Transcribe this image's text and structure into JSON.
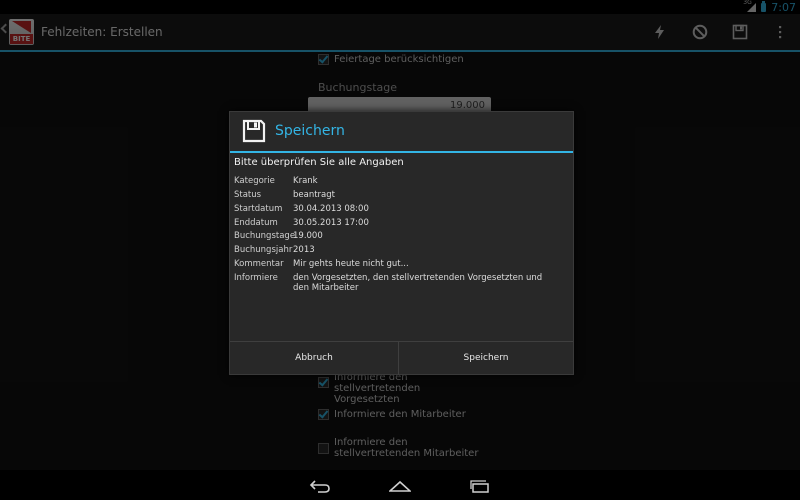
{
  "status_bar": {
    "network": "3G",
    "time": "7:07",
    "accent": "#33b5e5"
  },
  "action_bar": {
    "logo_text": "BITE",
    "title": "Fehlzeiten: Erstellen",
    "icons": [
      "flash-icon",
      "block-icon",
      "save-icon",
      "overflow-menu-icon"
    ]
  },
  "form": {
    "holidays_label": "Feiertage berücksichtigen",
    "booking_days_header": "Buchungstage",
    "booking_days_value": "19.000",
    "inform_deputy_label": "Informiere den stellvertretenden Vorgesetzten",
    "inform_employee_label": "Informiere den Mitarbeiter",
    "inform_deputy_employee_label": "Informiere den stellvertretenden Mitarbeiter"
  },
  "dialog": {
    "title": "Speichern",
    "subtitle": "Bitte überprüfen Sie alle Angaben",
    "rows": [
      {
        "key": "Kategorie",
        "value": "Krank"
      },
      {
        "key": "Status",
        "value": "beantragt"
      },
      {
        "key": "Startdatum",
        "value": "30.04.2013 08:00"
      },
      {
        "key": "Enddatum",
        "value": "30.05.2013 17:00"
      },
      {
        "key": "Buchungstage",
        "value": "19.000"
      },
      {
        "key": "Buchungsjahr",
        "value": "2013"
      },
      {
        "key": "Kommentar",
        "value": "Mir gehts heute nicht gut..."
      },
      {
        "key": "Informiere",
        "value": "den Vorgesetzten, den stellvertretenden Vorgesetzten und den Mitarbeiter"
      }
    ],
    "cancel_label": "Abbruch",
    "save_label": "Speichern"
  }
}
